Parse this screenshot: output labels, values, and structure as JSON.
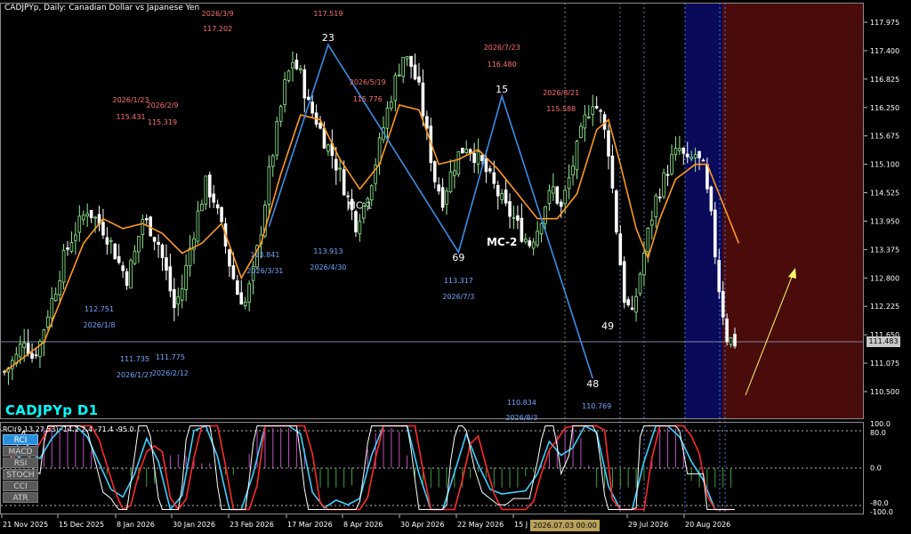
{
  "chart_title": "CADJPYp, Daily:  Canadian Dollar vs Japanese Yen",
  "symbol_label": "CADJPYp D1",
  "current_price_label": "111.483",
  "crosshair_time_label": "2026.07.03 00:00",
  "indicator_header": "RCI(9,13,27,53) -14.2 2.4 -71.4 -95.0",
  "indicator_buttons": [
    {
      "label": "RCI",
      "active": true
    },
    {
      "label": "MACD",
      "active": false
    },
    {
      "label": "RSI",
      "active": false
    },
    {
      "label": "STOCH",
      "active": false
    },
    {
      "label": "CCI",
      "active": false
    },
    {
      "label": "ATR",
      "active": false
    }
  ],
  "colors": {
    "background": "#000000",
    "bull_candle": "#90ee90",
    "bear_candle": "#ffffff",
    "ma_line": "#ff9a1e",
    "zigzag": "#3a8fe8",
    "zone_blue": "#0a0a5a",
    "zone_red": "#4a0b0b",
    "upper_annotation": "#ff7070",
    "lower_annotation": "#6ea8ff",
    "arrow": "#ffff66"
  },
  "chart_data": [
    {
      "type": "candlestick",
      "title": "CADJPYp, Daily:  Canadian Dollar vs Japanese Yen",
      "y_ticks": [
        "117.975",
        "117.400",
        "116.825",
        "116.250",
        "115.675",
        "115.100",
        "114.525",
        "113.950",
        "113.375",
        "112.800",
        "112.225",
        "111.650",
        "111.075",
        "110.500"
      ],
      "x_ticks": [
        "21 Nov 2025",
        "15 Dec 2025",
        "8 Jan 2026",
        "30 Jan 2026",
        "23 Feb 2026",
        "17 Mar 2026",
        "8 Apr 2026",
        "30 Apr 2026",
        "22 May 2026",
        "15 J",
        "29 Jul 2026",
        "20 Aug 2026"
      ],
      "ylim": [
        110.1,
        118.2
      ],
      "grid": false,
      "close_path": [
        [
          0,
          110.9
        ],
        [
          3,
          111.2
        ],
        [
          5,
          111.6
        ],
        [
          7,
          111.2
        ],
        [
          9,
          111.5
        ],
        [
          11,
          112.1
        ],
        [
          13,
          112.6
        ],
        [
          15,
          113.2
        ],
        [
          17,
          113.6
        ],
        [
          19,
          113.9
        ],
        [
          21,
          114.2
        ],
        [
          23,
          114.0
        ],
        [
          25,
          113.8
        ],
        [
          27,
          113.5
        ],
        [
          29,
          113.1
        ],
        [
          31,
          112.8
        ],
        [
          33,
          113.3
        ],
        [
          35,
          114.0
        ],
        [
          37,
          113.8
        ],
        [
          39,
          113.5
        ],
        [
          41,
          112.9
        ],
        [
          43,
          112.2
        ],
        [
          45,
          112.6
        ],
        [
          47,
          113.4
        ],
        [
          49,
          114.1
        ],
        [
          51,
          114.7
        ],
        [
          53,
          114.4
        ],
        [
          55,
          113.8
        ],
        [
          57,
          113.1
        ],
        [
          59,
          112.5
        ],
        [
          61,
          112.3
        ],
        [
          63,
          112.9
        ],
        [
          65,
          113.8
        ],
        [
          67,
          114.9
        ],
        [
          69,
          115.8
        ],
        [
          71,
          116.7
        ],
        [
          73,
          117.2
        ],
        [
          75,
          116.9
        ],
        [
          77,
          116.3
        ],
        [
          79,
          116.0
        ],
        [
          81,
          115.6
        ],
        [
          83,
          115.3
        ],
        [
          85,
          114.9
        ],
        [
          87,
          114.4
        ],
        [
          89,
          113.9
        ],
        [
          91,
          114.3
        ],
        [
          93,
          114.8
        ],
        [
          95,
          115.5
        ],
        [
          97,
          116.2
        ],
        [
          99,
          116.8
        ],
        [
          101,
          117.3
        ],
        [
          103,
          117.1
        ],
        [
          105,
          116.6
        ],
        [
          107,
          115.7
        ],
        [
          109,
          114.8
        ],
        [
          111,
          114.4
        ],
        [
          113,
          114.9
        ],
        [
          115,
          115.3
        ],
        [
          117,
          115.5
        ],
        [
          119,
          115.3
        ],
        [
          121,
          115.1
        ],
        [
          123,
          114.8
        ],
        [
          125,
          114.5
        ],
        [
          127,
          114.2
        ],
        [
          129,
          114.0
        ],
        [
          131,
          113.7
        ],
        [
          133,
          113.5
        ],
        [
          135,
          113.8
        ],
        [
          137,
          114.3
        ],
        [
          139,
          114.6
        ],
        [
          141,
          114.2
        ],
        [
          143,
          114.8
        ],
        [
          145,
          115.4
        ],
        [
          147,
          116.0
        ],
        [
          149,
          116.4
        ],
        [
          151,
          116.1
        ],
        [
          153,
          115.4
        ],
        [
          155,
          113.8
        ],
        [
          157,
          112.4
        ],
        [
          159,
          112.0
        ],
        [
          161,
          112.9
        ],
        [
          163,
          113.7
        ],
        [
          165,
          114.4
        ],
        [
          167,
          114.8
        ],
        [
          169,
          115.2
        ],
        [
          171,
          115.4
        ],
        [
          173,
          115.1
        ],
        [
          175,
          115.3
        ],
        [
          177,
          115.0
        ],
        [
          179,
          114.0
        ],
        [
          181,
          112.6
        ],
        [
          183,
          111.6
        ],
        [
          185,
          111.5
        ]
      ],
      "bars_count": 186,
      "moving_average": [
        [
          0,
          110.9
        ],
        [
          10,
          111.5
        ],
        [
          20,
          113.5
        ],
        [
          25,
          114.0
        ],
        [
          30,
          113.8
        ],
        [
          35,
          113.9
        ],
        [
          40,
          113.7
        ],
        [
          45,
          113.3
        ],
        [
          50,
          113.5
        ],
        [
          55,
          113.9
        ],
        [
          60,
          112.8
        ],
        [
          65,
          113.5
        ],
        [
          70,
          114.9
        ],
        [
          75,
          116.1
        ],
        [
          80,
          116.0
        ],
        [
          85,
          115.2
        ],
        [
          90,
          114.6
        ],
        [
          95,
          115.1
        ],
        [
          100,
          116.3
        ],
        [
          105,
          116.2
        ],
        [
          110,
          115.1
        ],
        [
          115,
          115.2
        ],
        [
          120,
          115.4
        ],
        [
          125,
          115.0
        ],
        [
          130,
          114.5
        ],
        [
          135,
          114.0
        ],
        [
          140,
          114.0
        ],
        [
          145,
          114.5
        ],
        [
          150,
          115.8
        ],
        [
          153,
          116.0
        ],
        [
          156,
          115.1
        ],
        [
          160,
          113.8
        ],
        [
          163,
          113.2
        ],
        [
          166,
          114.0
        ],
        [
          170,
          114.8
        ],
        [
          175,
          115.1
        ],
        [
          178,
          115.1
        ],
        [
          182,
          114.3
        ],
        [
          186,
          113.5
        ]
      ],
      "zigzag": [
        [
          67,
          113.84
        ],
        [
          82,
          117.52
        ],
        [
          115,
          113.32
        ],
        [
          126,
          116.48
        ],
        [
          149,
          110.77
        ]
      ],
      "zigzag_labels": [
        {
          "i": 82,
          "text": "23"
        },
        {
          "i": 115,
          "text": "69"
        },
        {
          "i": 126,
          "text": "15"
        },
        {
          "i": 149,
          "text": "48"
        },
        {
          "i": 151,
          "text": "49"
        }
      ],
      "wave_labels": [
        {
          "text": "MC-1",
          "i": 90,
          "y": 114.2
        },
        {
          "text": "MC-2",
          "i": 126,
          "y": 113.45
        }
      ],
      "upper_annotations": [
        {
          "date": "2026/3/9",
          "value": "117.202",
          "i": 54
        },
        {
          "date": "",
          "value": "117.519",
          "i": 82
        },
        {
          "date": "2026/1/23",
          "value": "115.431",
          "i": 32
        },
        {
          "date": "2026/2/9",
          "value": "115.319",
          "i": 40
        },
        {
          "date": "2026/5/19",
          "value": "115.776",
          "i": 92
        },
        {
          "date": "2026/7/23",
          "value": "116.480",
          "i": 126
        },
        {
          "date": "2026/8/21",
          "value": "115.588",
          "i": 141
        }
      ],
      "lower_annotations": [
        {
          "value": "112.751",
          "date": "2026/1/8",
          "i": 24
        },
        {
          "value": "113.841",
          "date": "2026/3/31",
          "i": 66
        },
        {
          "value": "113.913",
          "date": "2026/4/30",
          "i": 82
        },
        {
          "value": "113.317",
          "date": "2026/7/3",
          "i": 115
        },
        {
          "value": "111.735",
          "date": "2026/1/27",
          "i": 33
        },
        {
          "value": "111.775",
          "date": "2026/2/12",
          "i": 42
        },
        {
          "value": "110.834",
          "date": "2026/8/3",
          "i": 131
        },
        {
          "value": "110.769",
          "date": "",
          "i": 150
        }
      ]
    },
    {
      "type": "line",
      "title": "RCI(9,13,27,53)",
      "values_header": [
        -14.2,
        2.4,
        -71.4,
        -95.0
      ],
      "y_ticks": [
        "100.0",
        "80.0",
        "0.0",
        "-80.0",
        "-100.0"
      ],
      "ylim": [
        -100,
        100
      ],
      "series": [
        {
          "color": "#ffffff",
          "name": "9"
        },
        {
          "color": "#ff2a2a",
          "name": "13"
        },
        {
          "color": "#3fd0ff",
          "name": "27"
        },
        {
          "color": "#d060d0",
          "name": "53"
        }
      ]
    }
  ]
}
